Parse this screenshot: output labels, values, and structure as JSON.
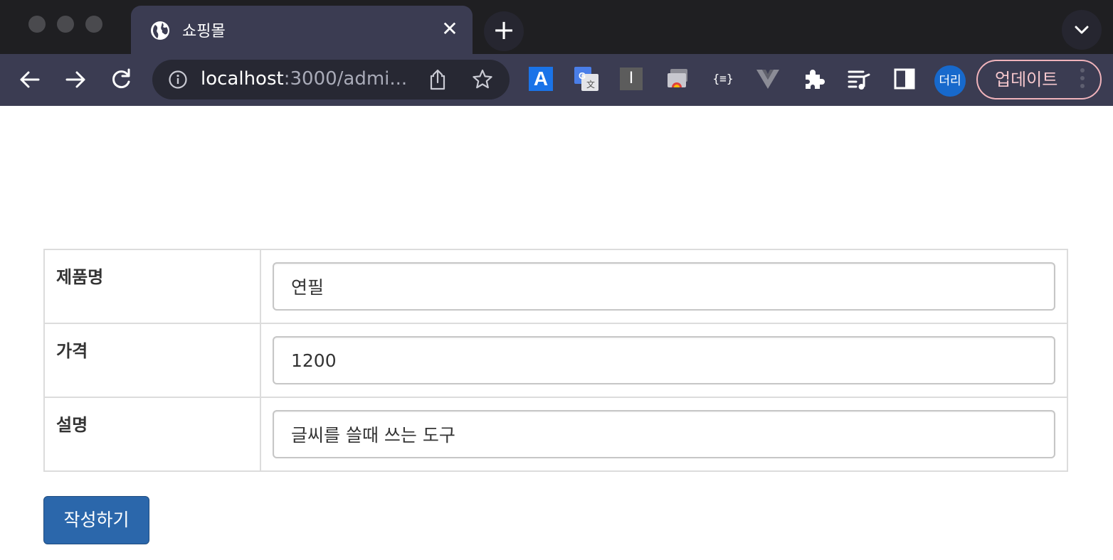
{
  "browser": {
    "tab": {
      "title": "쇼핑몰",
      "icon": "globe-icon",
      "close_label": "✕"
    },
    "newtab_label": "+",
    "omnibox": {
      "url_host": "localhost",
      "url_rest": ":3000/admi..."
    },
    "extensions": {
      "a_label": "A",
      "i_label": "I",
      "json_label": "{≡}"
    },
    "profile_label": "더리",
    "update_label": "업데이트"
  },
  "form": {
    "rows": [
      {
        "label": "제품명",
        "value": "연필"
      },
      {
        "label": "가격",
        "value": "1200"
      },
      {
        "label": "설명",
        "value": "글씨를 쓸때 쓰는 도구"
      }
    ],
    "submit_label": "작성하기"
  },
  "colors": {
    "tabstrip": "#1f1f22",
    "toolbar": "#3b3c52",
    "submit_button": "#2b67ab",
    "avatar": "#1769cc",
    "update_border": "#f0b3bb"
  }
}
